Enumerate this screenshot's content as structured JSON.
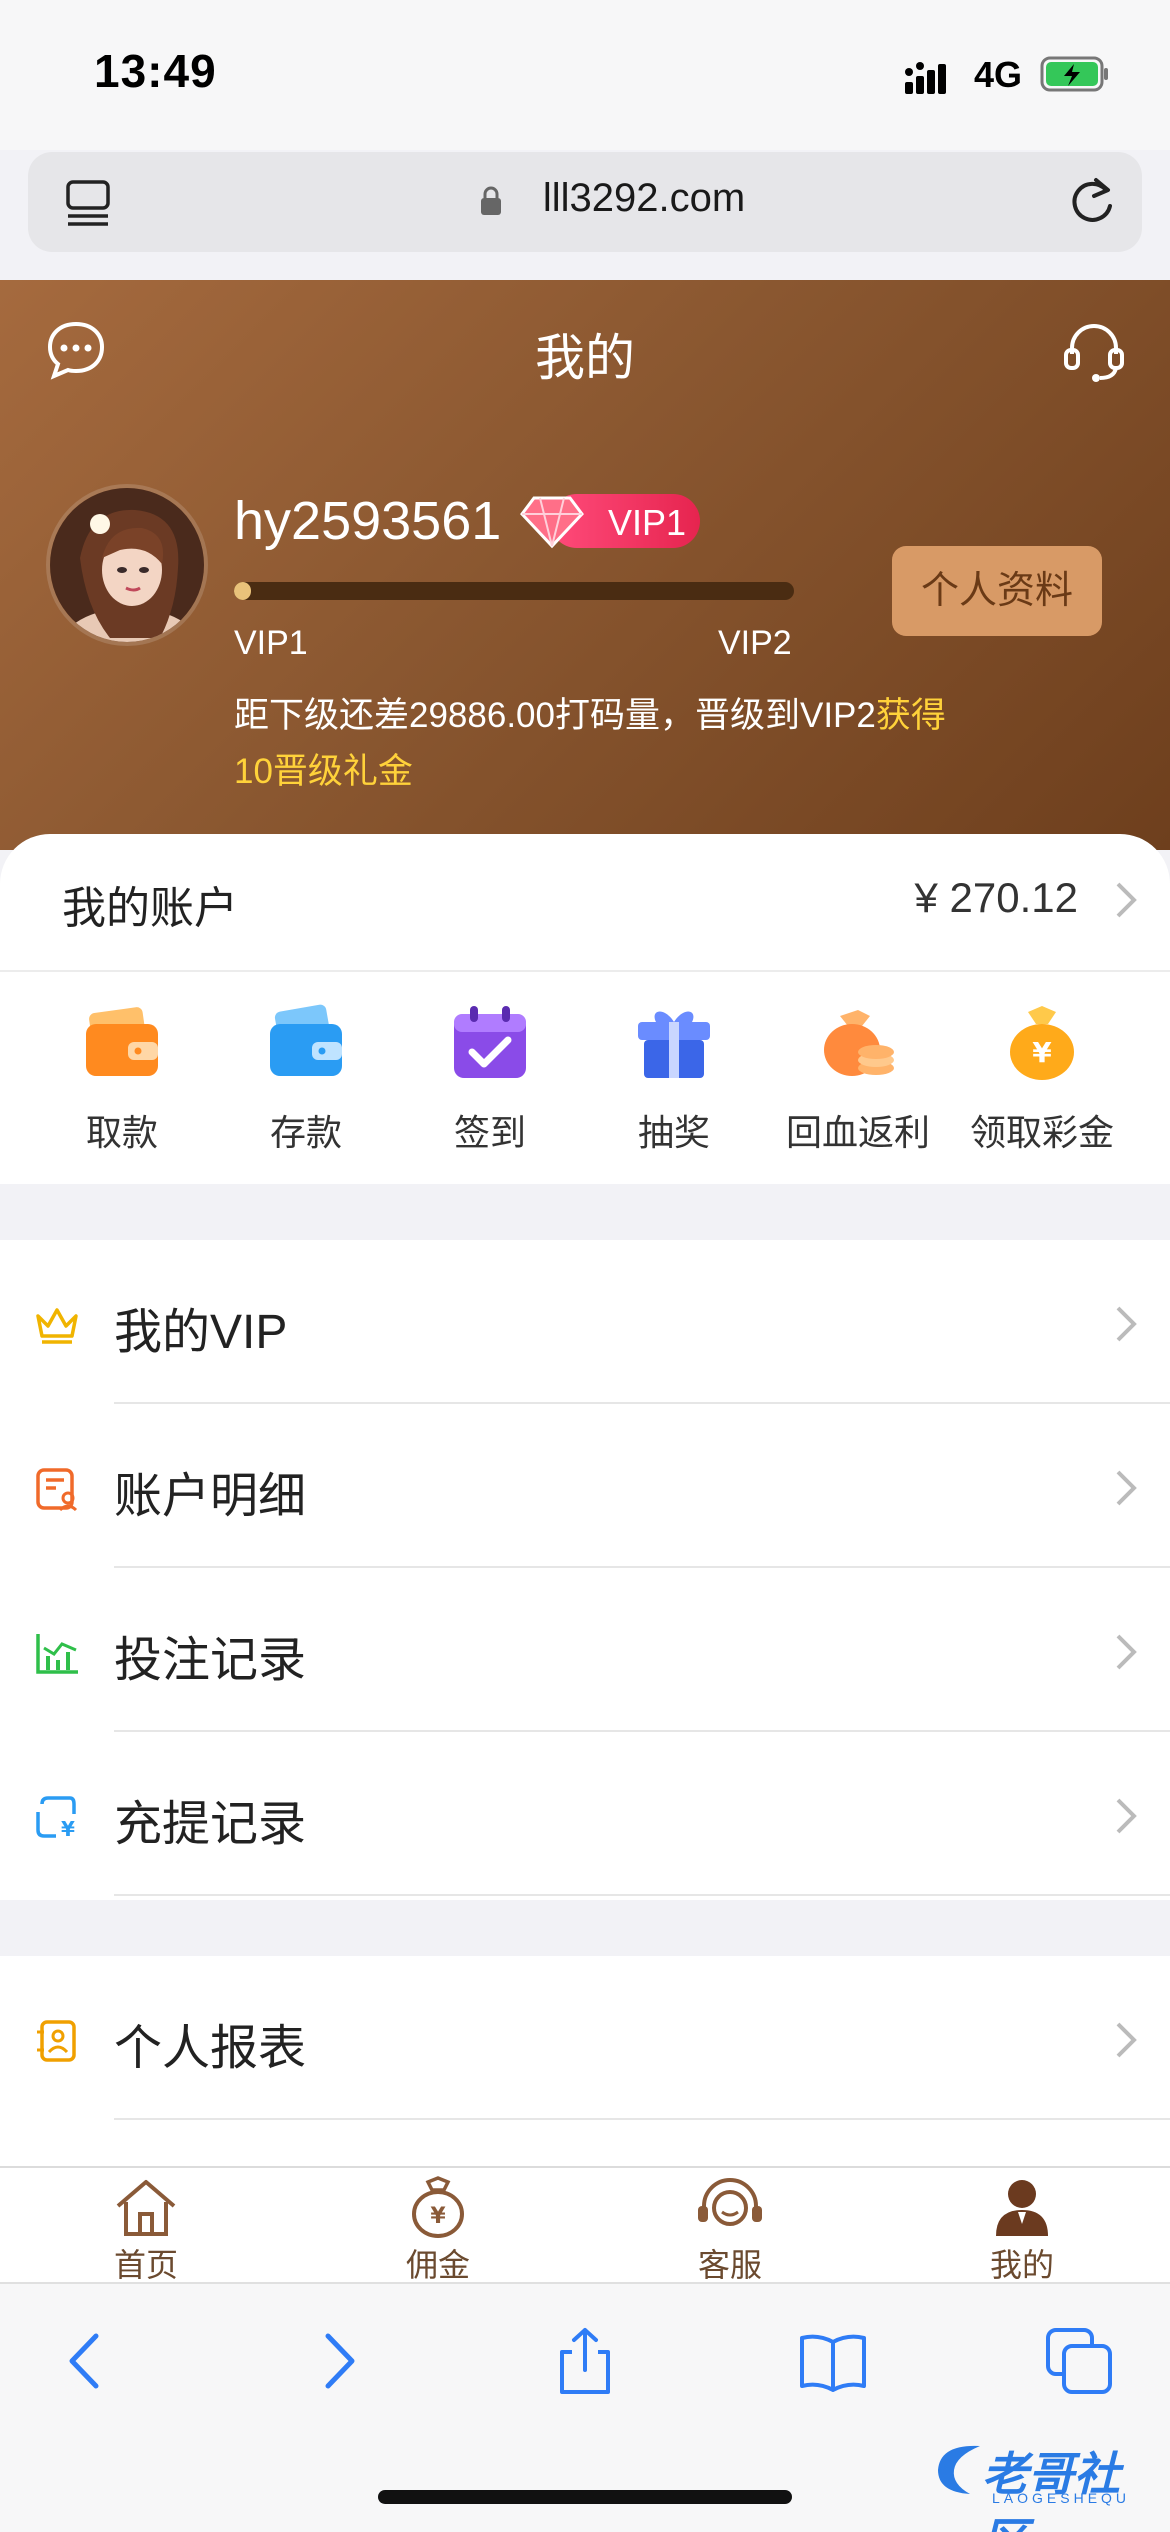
{
  "status_bar": {
    "time": "13:49",
    "network": "4G"
  },
  "browser": {
    "url": "lll3292.com"
  },
  "header": {
    "title": "我的",
    "username": "hy2593561",
    "vip_badge": "VIP1",
    "progress_percent": 3,
    "level_from": "VIP1",
    "level_to": "VIP2",
    "upgrade_text": "距下级还差29886.00打码量，晋级到VIP2",
    "upgrade_highlight_1": "获得",
    "upgrade_highlight_2": "10晋级礼金",
    "profile_button": "个人资料"
  },
  "account": {
    "label": "我的账户",
    "amount": "¥ 270.12"
  },
  "quick_actions": [
    {
      "label": "取款",
      "icon": "wallet-withdraw-icon",
      "color": "#ff8a1f"
    },
    {
      "label": "存款",
      "icon": "wallet-deposit-icon",
      "color": "#2a9cf3"
    },
    {
      "label": "签到",
      "icon": "calendar-check-icon",
      "color": "#8a4be8"
    },
    {
      "label": "抽奖",
      "icon": "gift-icon",
      "color": "#3b66e8"
    },
    {
      "label": "回血返利",
      "icon": "money-bag-coins-icon",
      "color": "#ff8a3d"
    },
    {
      "label": "领取彩金",
      "icon": "money-bag-yen-icon",
      "color": "#ffaa1a"
    }
  ],
  "menu": [
    {
      "label": "我的VIP",
      "icon": "crown-icon"
    },
    {
      "label": "账户明细",
      "icon": "account-detail-icon"
    },
    {
      "label": "投注记录",
      "icon": "bar-chart-icon"
    },
    {
      "label": "充提记录",
      "icon": "recharge-record-icon"
    }
  ],
  "menu2": [
    {
      "label": "个人报表",
      "icon": "report-icon"
    }
  ],
  "tabbar": [
    {
      "label": "首页",
      "icon": "home-icon"
    },
    {
      "label": "佣金",
      "icon": "commission-bag-icon"
    },
    {
      "label": "客服",
      "icon": "headset-icon"
    },
    {
      "label": "我的",
      "icon": "user-icon"
    }
  ],
  "watermark": {
    "text": "老哥社区",
    "sub": "LAOGESHEQU"
  },
  "colors": {
    "accent": "#8a5730",
    "highlight": "#ffd23a",
    "link": "#2f7cf6"
  }
}
